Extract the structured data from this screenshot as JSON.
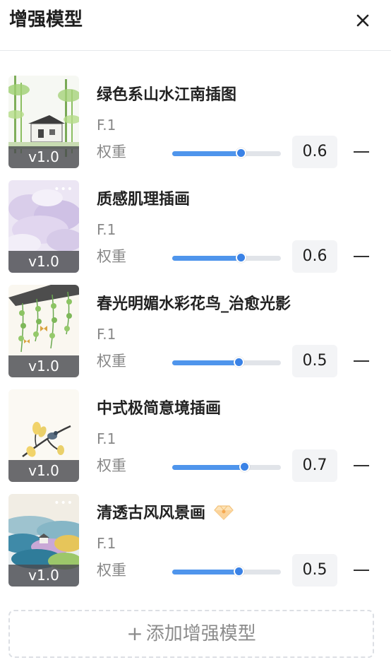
{
  "panel": {
    "title": "增强模型",
    "close_icon": "close-icon"
  },
  "items": [
    {
      "name": "绿色系山水江南插图",
      "model": "F.1",
      "weight_label": "权重",
      "weight": "0.6",
      "version": "v1.0",
      "has_more_dots": false,
      "badge_icon": null
    },
    {
      "name": "质感肌理插画",
      "model": "F.1",
      "weight_label": "权重",
      "weight": "0.6",
      "version": "v1.0",
      "has_more_dots": true,
      "badge_icon": null
    },
    {
      "name": "春光明媚水彩花鸟_治愈光影",
      "model": "F.1",
      "weight_label": "权重",
      "weight": "0.5",
      "version": "v1.0",
      "has_more_dots": false,
      "badge_icon": null
    },
    {
      "name": "中式极简意境插画",
      "model": "F.1",
      "weight_label": "权重",
      "weight": "0.7",
      "version": "v1.0",
      "has_more_dots": false,
      "badge_icon": null
    },
    {
      "name": "清透古风风景画",
      "model": "F.1",
      "weight_label": "权重",
      "weight": "0.5",
      "version": "v1.0",
      "has_more_dots": true,
      "badge_icon": "diamond-icon"
    }
  ],
  "add_button": {
    "icon": "plus-icon",
    "label": "添加增强模型"
  },
  "colors": {
    "accent": "#4f95ec",
    "track": "#e1e4e9",
    "value_box": "#f3f4f6",
    "text_secondary": "#888888"
  }
}
